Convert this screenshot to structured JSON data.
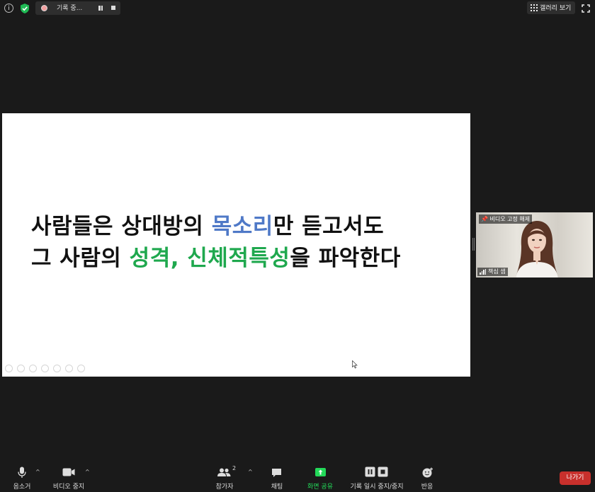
{
  "topbar": {
    "info_icon": "info-icon",
    "shield_icon": "shield-icon",
    "recording_label": "기록 중...",
    "gallery_label": "갤러리 보기"
  },
  "slide": {
    "line1_a": "사람들은 상대방의 ",
    "line1_b": "목소리",
    "line1_c": "만 듣고서도",
    "line2_a": "그 사람의 ",
    "line2_b": "성격, 신체적특성",
    "line2_c": "을 파악한다",
    "colors": {
      "text": "#111111",
      "blue": "#4f79c7",
      "green": "#1fa84e"
    }
  },
  "participant": {
    "pin_label": "비디오 고정 해제",
    "name": "책심 샘"
  },
  "toolbar": {
    "mute_label": "음소거",
    "video_label": "비디오 중지",
    "participants_label": "참가자",
    "participants_count": "2",
    "chat_label": "채팅",
    "share_label": "화면 공유",
    "record_label": "기록 일시 중지/중지",
    "reactions_label": "반응",
    "exit_label": "나가기",
    "colors": {
      "share": "#23d959",
      "exit": "#c8302c"
    }
  }
}
